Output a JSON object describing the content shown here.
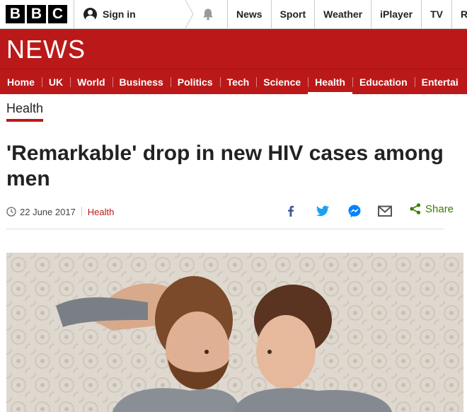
{
  "topbar": {
    "logo_letters": [
      "B",
      "B",
      "C"
    ],
    "sign_in_label": "Sign in",
    "links": [
      "News",
      "Sport",
      "Weather",
      "iPlayer",
      "TV",
      "Rad"
    ]
  },
  "banner": {
    "wordmark": "NEWS"
  },
  "nav": {
    "items": [
      "Home",
      "UK",
      "World",
      "Business",
      "Politics",
      "Tech",
      "Science",
      "Health",
      "Education",
      "Entertai"
    ],
    "active": "Health"
  },
  "section_label": "Health",
  "article": {
    "headline": "'Remarkable' drop in new HIV cases among men",
    "date": "22 June 2017",
    "category": "Health"
  },
  "share": {
    "label": "Share",
    "icons": [
      "facebook-icon",
      "twitter-icon",
      "messenger-icon",
      "email-icon",
      "share-icon"
    ]
  },
  "colors": {
    "brand_red": "#bb1919",
    "share_green": "#3d7c00",
    "facebook": "#3b5998",
    "twitter": "#1da1f2",
    "messenger": "#0084ff"
  }
}
